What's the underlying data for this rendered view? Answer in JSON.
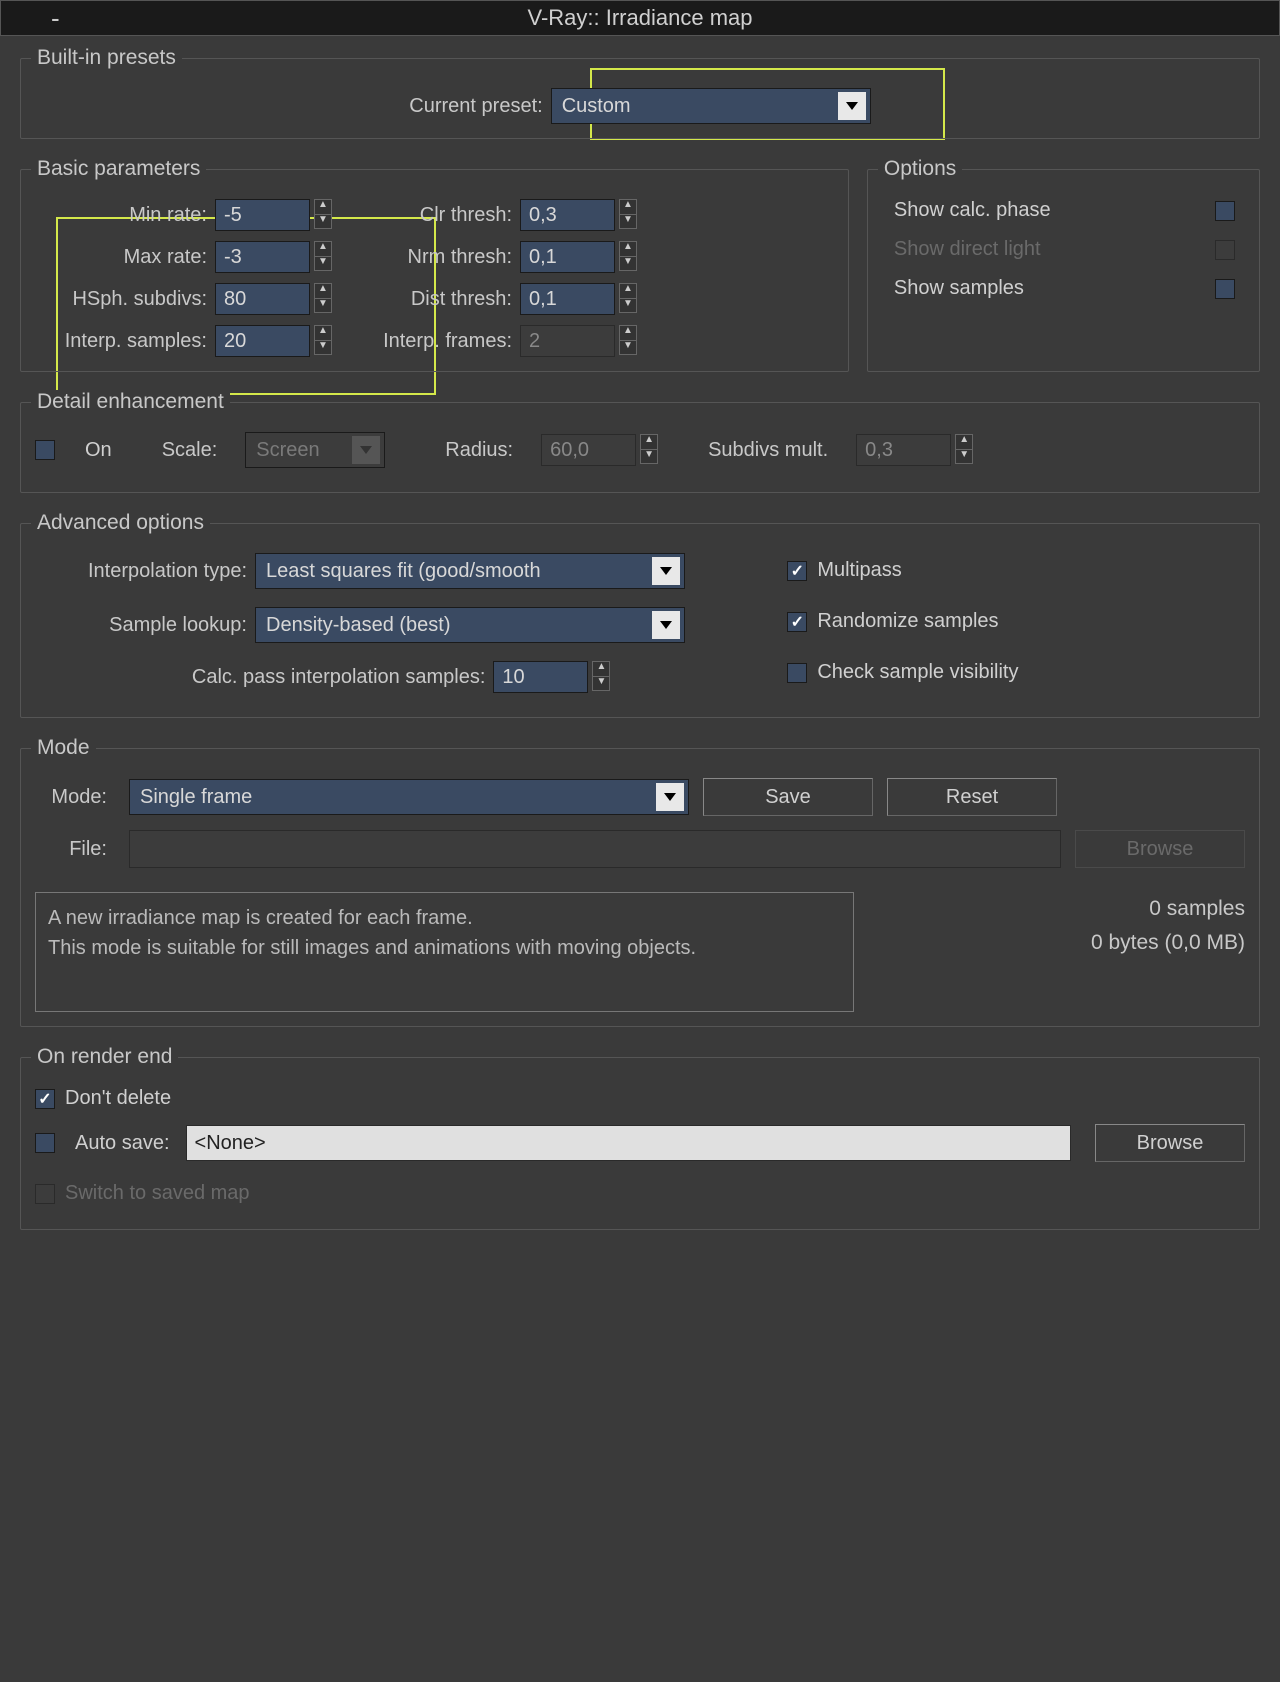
{
  "title": "V-Ray:: Irradiance map",
  "presets": {
    "legend": "Built-in presets",
    "current_label": "Current preset:",
    "current_value": "Custom"
  },
  "basic": {
    "legend": "Basic parameters",
    "min_rate_label": "Min rate:",
    "min_rate": "-5",
    "max_rate_label": "Max rate:",
    "max_rate": "-3",
    "hsph_label": "HSph. subdivs:",
    "hsph": "80",
    "interp_samples_label": "Interp. samples:",
    "interp_samples": "20",
    "clr_thresh_label": "Clr thresh:",
    "clr_thresh": "0,3",
    "nrm_thresh_label": "Nrm thresh:",
    "nrm_thresh": "0,1",
    "dist_thresh_label": "Dist thresh:",
    "dist_thresh": "0,1",
    "interp_frames_label": "Interp. frames:",
    "interp_frames": "2"
  },
  "options": {
    "legend": "Options",
    "show_calc": "Show calc. phase",
    "show_direct": "Show direct light",
    "show_samples": "Show samples"
  },
  "detail": {
    "legend": "Detail enhancement",
    "on_label": "On",
    "scale_label": "Scale:",
    "scale_value": "Screen",
    "radius_label": "Radius:",
    "radius": "60,0",
    "subdivs_label": "Subdivs mult.",
    "subdivs": "0,3"
  },
  "advanced": {
    "legend": "Advanced options",
    "interp_type_label": "Interpolation type:",
    "interp_type": "Least squares fit (good/smooth",
    "sample_lookup_label": "Sample lookup:",
    "sample_lookup": "Density-based (best)",
    "calc_pass_label": "Calc. pass interpolation samples:",
    "calc_pass": "10",
    "multipass": "Multipass",
    "randomize": "Randomize samples",
    "check_vis": "Check sample visibility"
  },
  "mode": {
    "legend": "Mode",
    "mode_label": "Mode:",
    "mode_value": "Single frame",
    "save": "Save",
    "reset": "Reset",
    "file_label": "File:",
    "browse": "Browse",
    "info_line1": "A new irradiance map is created for each frame.",
    "info_line2": "This mode is suitable for still images and animations with moving objects.",
    "stats_samples": "0 samples",
    "stats_bytes": "0 bytes (0,0 MB)"
  },
  "render_end": {
    "legend": "On render end",
    "dont_delete": "Don't delete",
    "auto_save": "Auto save:",
    "auto_save_value": "<None>",
    "browse": "Browse",
    "switch": "Switch to saved map"
  }
}
